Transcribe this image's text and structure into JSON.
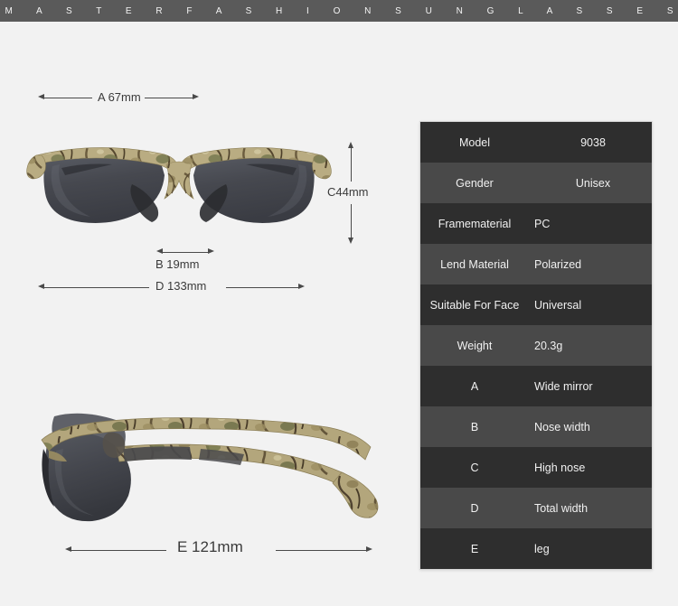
{
  "banner": {
    "brand_text": "M A S T E R F A S H I O N S U N G L A S S E S",
    "background_color": "#5a5a5a",
    "text_color": "#f4f4f4"
  },
  "page": {
    "background_color": "#f2f2f2"
  },
  "product": {
    "frame_pattern": "camouflage",
    "frame_color": "#b5a87e",
    "frame_dark_color": "#6b5c3e",
    "frame_green_color": "#7d7f55",
    "lens_color": "#44464e",
    "front_view_alt": "sunglasses-front-view",
    "side_view_alt": "sunglasses-side-view"
  },
  "dimensions": {
    "a": "A 67mm",
    "b": "B 19mm",
    "c": "C44mm",
    "d": "D 133mm",
    "e": "E 121mm"
  },
  "spec_table": {
    "rows": [
      {
        "key": "Model",
        "value": "9038"
      },
      {
        "key": "Gender",
        "value": "Unisex"
      },
      {
        "key": "Framematerial",
        "value": "PC"
      },
      {
        "key": "Lend Material",
        "value": "Polarized"
      },
      {
        "key": "Suitable For Face",
        "value": "Universal"
      },
      {
        "key": "Weight",
        "value": "20.3g"
      },
      {
        "key": "A",
        "value": "Wide mirror"
      },
      {
        "key": "B",
        "value": "Nose width"
      },
      {
        "key": "C",
        "value": "High nose"
      },
      {
        "key": "D",
        "value": "Total width"
      },
      {
        "key": "E",
        "value": "leg"
      }
    ],
    "row_color_odd": "#2e2e2e",
    "row_color_even": "#494949",
    "text_color": "#f0f0f0"
  }
}
